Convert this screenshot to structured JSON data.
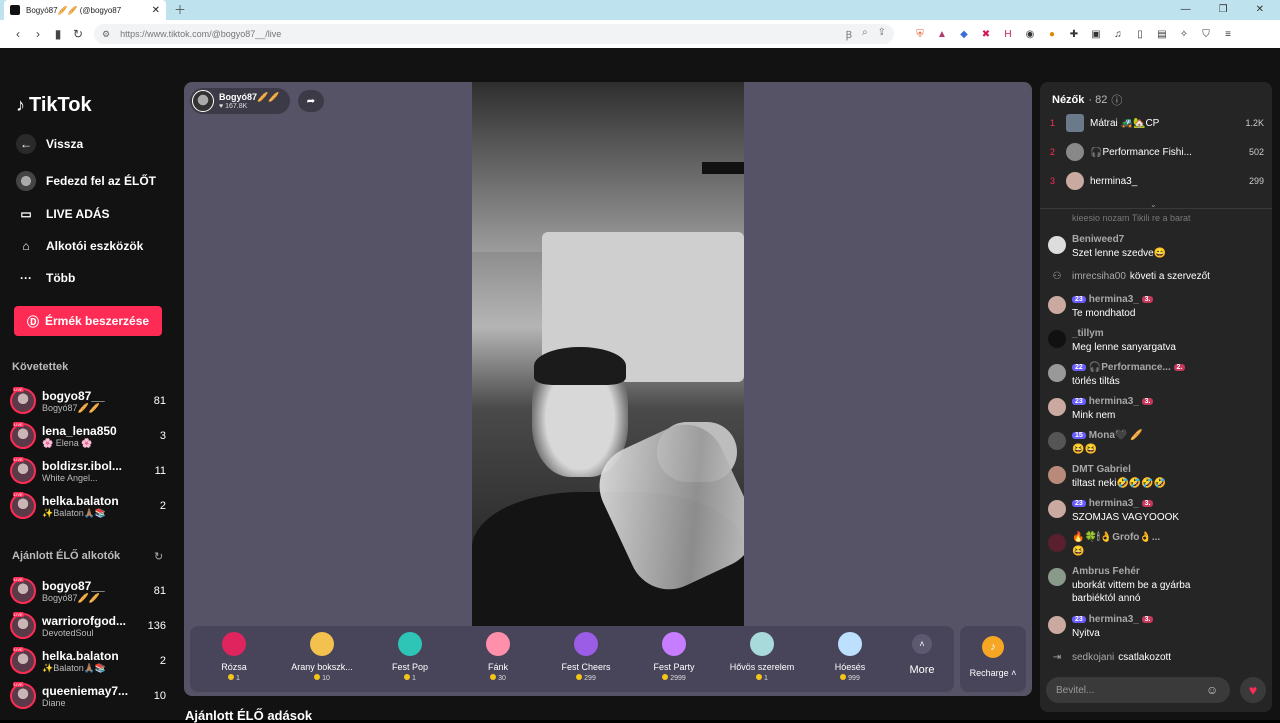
{
  "browser": {
    "tab_title": "Bogyó87🥖🥖 (@bogyo87",
    "url": "https://www.tiktok.com/@bogyo87__/live"
  },
  "sidebar": {
    "logo": "TikTok",
    "nav": [
      {
        "label": "Vissza",
        "icon": "arrow-left-icon"
      },
      {
        "label": "Fedezd fel az ÉLŐT",
        "icon": "avatar"
      },
      {
        "label": "LIVE ADÁS",
        "icon": "camera-icon"
      },
      {
        "label": "Alkotói eszközök",
        "icon": "lightbulb-icon"
      },
      {
        "label": "Több",
        "icon": "more-icon"
      }
    ],
    "coin_button": "Érmék beszerzése",
    "followed_title": "Követettek",
    "followed": [
      {
        "name": "bogyo87__",
        "sub": "Bogyó87🥖🥖",
        "count": "81"
      },
      {
        "name": "lena_lena850",
        "sub": "🌸 Elena 🌸",
        "count": "3"
      },
      {
        "name": "boldizsr.ibol...",
        "sub": "White Angel...",
        "count": "11"
      },
      {
        "name": "helka.balaton",
        "sub": "✨Balaton🙏🏽📚",
        "count": "2"
      }
    ],
    "recommended_title": "Ajánlott ÉLŐ alkotók",
    "recommended": [
      {
        "name": "bogyo87__",
        "sub": "Bogyó87🥖🥖",
        "count": "81"
      },
      {
        "name": "warriorofgod...",
        "sub": "DevotedSoul",
        "count": "136"
      },
      {
        "name": "helka.balaton",
        "sub": "✨Balaton🙏🏽📚",
        "count": "2"
      },
      {
        "name": "queeniemay7...",
        "sub": "Diane",
        "count": "10"
      }
    ]
  },
  "stage": {
    "host_name": "Bogyó87🥖🥖",
    "host_likes": "♥ 167.8K",
    "gifts": [
      {
        "name": "Rózsa",
        "price": "1",
        "color": "#e0245e"
      },
      {
        "name": "Arany bokszk...",
        "price": "10",
        "color": "#f2c14e"
      },
      {
        "name": "Fest Pop",
        "price": "1",
        "color": "#2ec4b6"
      },
      {
        "name": "Fánk",
        "price": "30",
        "color": "#ff8fab"
      },
      {
        "name": "Fest Cheers",
        "price": "299",
        "color": "#9b5de5"
      },
      {
        "name": "Fest Party",
        "price": "2999",
        "color": "#c77dff"
      },
      {
        "name": "Hővös szerelem",
        "price": "1",
        "color": "#a8dadc"
      },
      {
        "name": "Hóesés",
        "price": "999",
        "color": "#bde0fe"
      }
    ],
    "more_label": "More",
    "recharge_label": "Recharge ˄"
  },
  "recommended_streams_title": "Ajánlott ÉLŐ adások",
  "chat": {
    "viewers_label": "Nézők",
    "viewers_count": "· 82",
    "ranking": [
      {
        "rank": "1",
        "name": "Mátrai 🚜🏡CP",
        "score": "1.2K"
      },
      {
        "rank": "2",
        "name": "🎧Performance Fishi...",
        "score": "502"
      },
      {
        "rank": "3",
        "name": "hermina3_",
        "score": "299"
      }
    ],
    "faded_text": "kieesio nozam Tikili re a barat",
    "messages": [
      {
        "type": "msg",
        "name": "Beniweed7",
        "text": "Szet lenne szedve😄"
      },
      {
        "type": "sys",
        "name": "imrecsiha00",
        "text": "követi a szervezőt"
      },
      {
        "type": "msg",
        "name": "hermina3_",
        "lvl": "23",
        "fan": "3.",
        "text": "Te mondhatod"
      },
      {
        "type": "msg",
        "name": "_tillym",
        "text": "Meg lenne sanyargatva"
      },
      {
        "type": "msg",
        "name": "🎧Performance...",
        "lvl": "22",
        "fan": "2.",
        "text": "törlés tiltás"
      },
      {
        "type": "msg",
        "name": "hermina3_",
        "lvl": "23",
        "fan": "3.",
        "text": "Mink nem"
      },
      {
        "type": "msg",
        "name": "Mona🖤 🥖",
        "lvl": "15",
        "text": "😆😆"
      },
      {
        "type": "msg",
        "name": "DMT Gabriel",
        "text": "tiltast neki🤣🤣🤣🤣"
      },
      {
        "type": "msg",
        "name": "hermina3_",
        "lvl": "23",
        "fan": "3.",
        "text": "SZOMJAS VAGYOOOK"
      },
      {
        "type": "msg",
        "name": "🔥🍀🕯👌Grofo👌...",
        "text": "😆"
      },
      {
        "type": "msg",
        "name": "Ambrus Fehér",
        "text": "uborkát vittem be a gyárba barbiéktól annó"
      },
      {
        "type": "msg",
        "name": "hermina3_",
        "lvl": "23",
        "fan": "3.",
        "text": "Nyitva"
      },
      {
        "type": "sys",
        "name": "sedkojani",
        "text": "csatlakozott"
      }
    ],
    "input_placeholder": "Bevitel..."
  }
}
